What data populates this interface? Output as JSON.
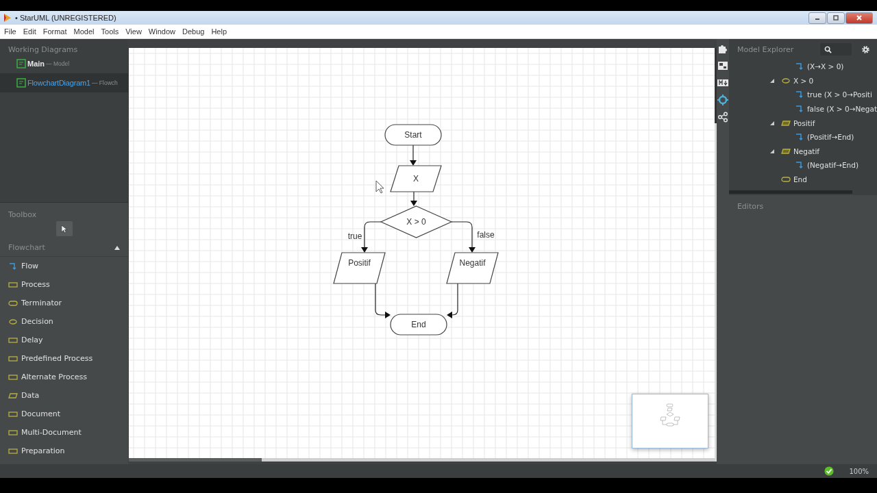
{
  "window": {
    "title": "• StarUML (UNREGISTERED)"
  },
  "menu": [
    "File",
    "Edit",
    "Format",
    "Model",
    "Tools",
    "View",
    "Window",
    "Debug",
    "Help"
  ],
  "working_diagrams": {
    "title": "Working Diagrams",
    "items": [
      {
        "name": "Main",
        "type": "— Model",
        "selected": false
      },
      {
        "name": "FlowchartDiagram1",
        "type": "— Flowch",
        "selected": true
      }
    ]
  },
  "toolbox": {
    "title": "Toolbox",
    "group": {
      "title": "Flowchart",
      "expanded": true
    },
    "items": [
      {
        "kind": "flow",
        "label": "Flow"
      },
      {
        "kind": "process",
        "label": "Process"
      },
      {
        "kind": "terminator",
        "label": "Terminator"
      },
      {
        "kind": "decision",
        "label": "Decision"
      },
      {
        "kind": "delay",
        "label": "Delay"
      },
      {
        "kind": "predefined",
        "label": "Predefined Process"
      },
      {
        "kind": "alternate",
        "label": "Alternate Process"
      },
      {
        "kind": "data",
        "label": "Data"
      },
      {
        "kind": "document",
        "label": "Document"
      },
      {
        "kind": "multidoc",
        "label": "Multi-Document"
      },
      {
        "kind": "preparation",
        "label": "Preparation"
      }
    ]
  },
  "diagram": {
    "nodes": [
      {
        "kind": "terminator",
        "label": "Start"
      },
      {
        "kind": "data",
        "label": "X"
      },
      {
        "kind": "decision",
        "label": "X > 0"
      },
      {
        "kind": "data",
        "label": "Positif"
      },
      {
        "kind": "data",
        "label": "Negatif"
      },
      {
        "kind": "terminator",
        "label": "End"
      }
    ],
    "flow_labels": [
      "true",
      "false"
    ]
  },
  "model_explorer": {
    "title": "Model Explorer",
    "items": [
      {
        "kind": "flow",
        "label": "(X→X > 0)"
      },
      {
        "kind": "decision",
        "label": "X > 0",
        "expanded": true,
        "children": [
          {
            "kind": "flow",
            "label": "true (X > 0→Positi"
          },
          {
            "kind": "flow",
            "label": "false (X > 0→Negat"
          }
        ]
      },
      {
        "kind": "data",
        "label": "Positif",
        "expanded": true,
        "children": [
          {
            "kind": "flow",
            "label": "(Positif→End)"
          }
        ]
      },
      {
        "kind": "data",
        "label": "Negatif",
        "expanded": true,
        "children": [
          {
            "kind": "flow",
            "label": "(Negatif→End)"
          }
        ]
      },
      {
        "kind": "terminator",
        "label": "End"
      }
    ]
  },
  "editors": {
    "title": "Editors"
  },
  "status_bar": {
    "zoom": "100%"
  }
}
